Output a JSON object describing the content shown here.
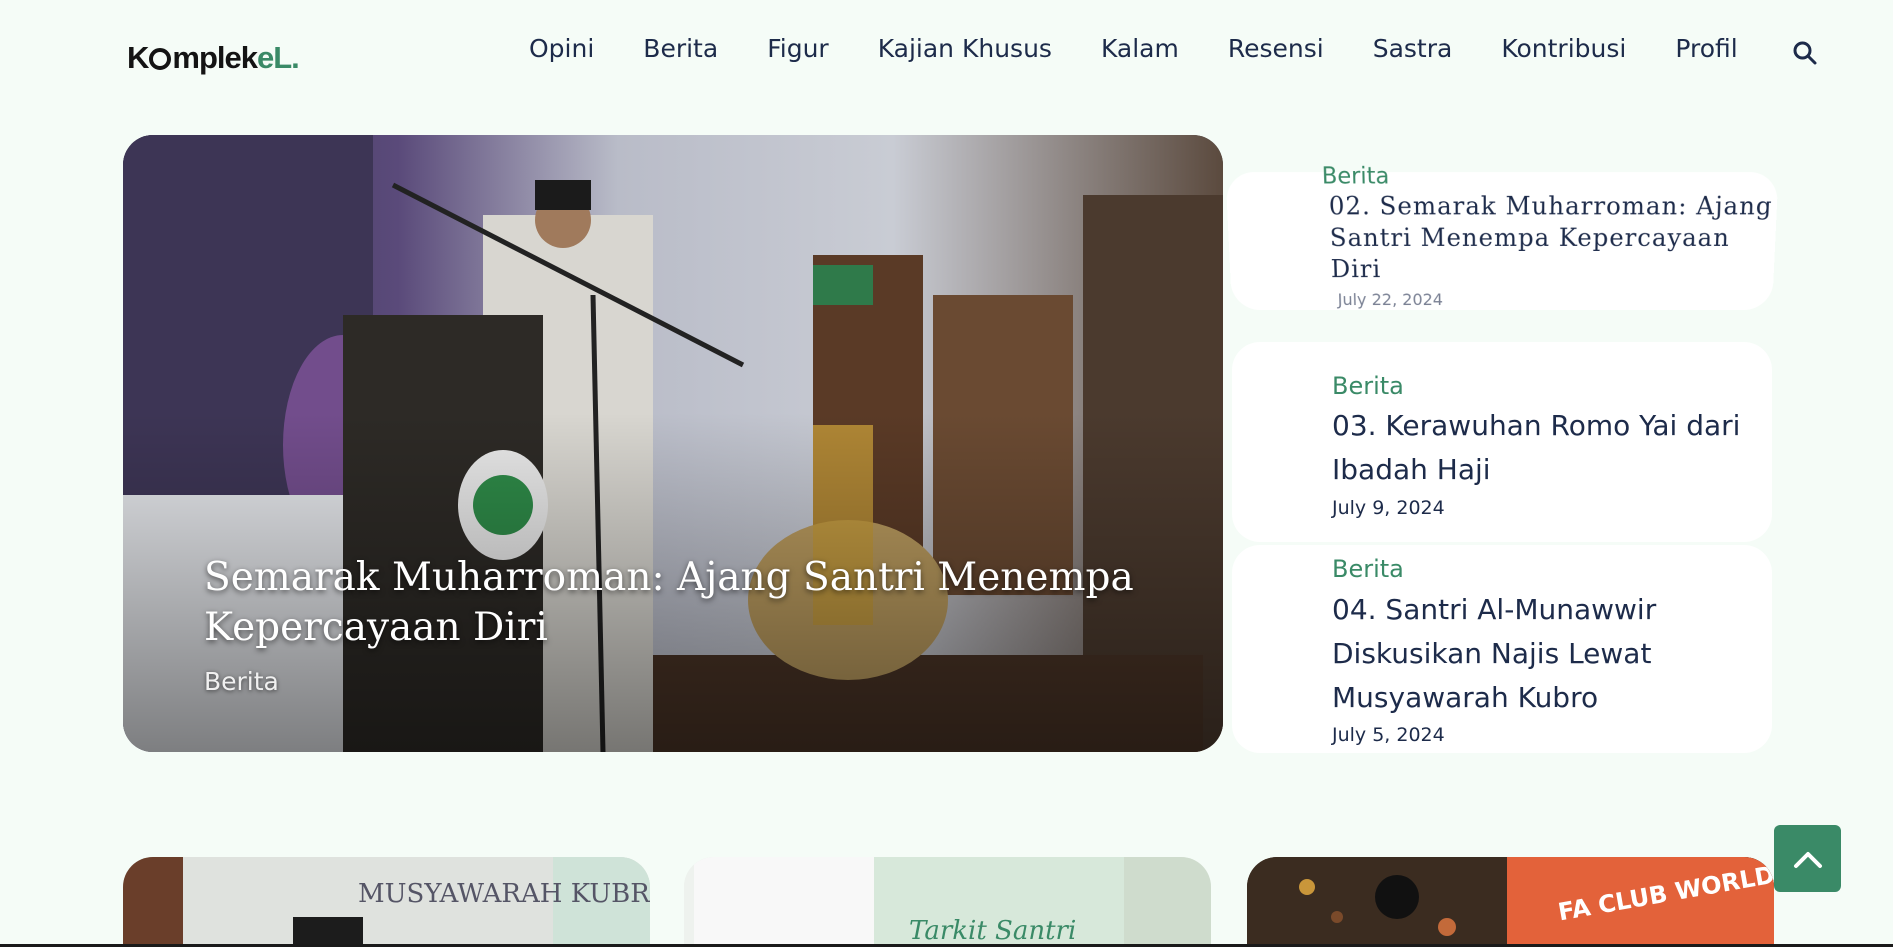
{
  "logo": {
    "part1": "K",
    "part2": "mplek",
    "part3": "eL."
  },
  "nav": {
    "items": [
      "Opini",
      "Berita",
      "Figur",
      "Kajian Khusus",
      "Kalam",
      "Resensi",
      "Sastra",
      "Kontribusi",
      "Profil"
    ],
    "search_icon": "search-icon"
  },
  "hero": {
    "title": "Semarak Muharroman: Ajang Santri Menempa Kepercayaan Diri",
    "category": "Berita"
  },
  "side": [
    {
      "category": "Berita",
      "title": "02. Semarak Muharroman: Ajang Santri Menempa Kepercayaan Diri",
      "date": "July 22, 2024"
    },
    {
      "category": "Berita",
      "title": "03. Kerawuhan Romo Yai dari Ibadah Haji",
      "date": "July 9, 2024"
    },
    {
      "category": "Berita",
      "title": "04. Santri Al-Munawwir Diskusikan Najis Lewat Musyawarah Kubro",
      "date": "July 5, 2024"
    }
  ],
  "thumbs": {
    "t1_text": "MUSYAWARAH KUBRO",
    "t2_text": "Tarkit Santri",
    "t3_text": "FA CLUB WORLD"
  },
  "colors": {
    "accent": "#3a8a67",
    "text": "#1d2b4a",
    "background": "#f5fcf7"
  },
  "back_to_top_icon": "chevron-up-icon"
}
